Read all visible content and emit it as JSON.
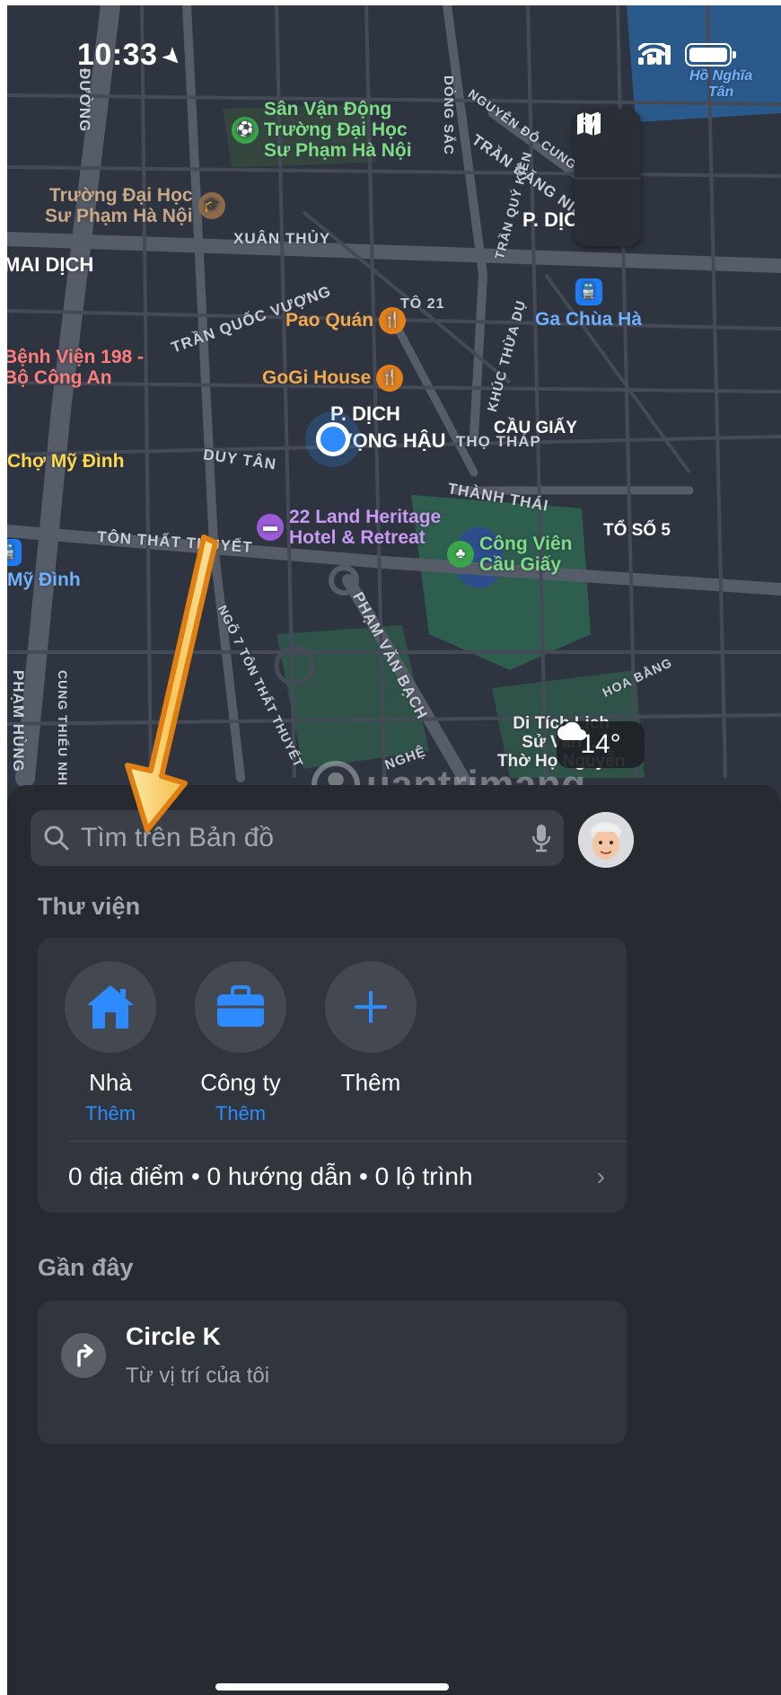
{
  "status_bar": {
    "time": "10:33"
  },
  "map": {
    "roads": [
      "ĐƯỜNG",
      "XUÂN THỦY",
      "TRẦN QUỐC VƯỢNG",
      "DUY TÂN",
      "TÔN THẤT THUYẾT",
      "NGÕ 7 TÔN THẤT THUYẾT",
      "PHẠM VĂN BẠCH",
      "PHẠM HÙNG",
      "CUNG THIẾU NHI",
      "NGUYỄN ĐỖ CUNG",
      "TRẦN ĐĂNG NINH",
      "TRẦN QUÝ KIÊN",
      "KHÚC THỪA DỤ",
      "THỌ THÁP",
      "THÀNH THÁI",
      "TÔ 21",
      "HOA BẰNG",
      "DÒNG SẮC",
      "NGHỆ"
    ],
    "areas": [
      "P. DỊCH",
      "P. DỊCH",
      "VỌNG HẬU",
      "MAI DỊCH",
      "CẦU GIẤY",
      "TỔ SỐ 5"
    ],
    "pois": {
      "stadium": [
        "Sân Vận Động",
        "Trường Đại Học",
        "Sư Phạm Hà Nội"
      ],
      "university": [
        "Trường Đại Học",
        "Sư Phạm Hà Nội"
      ],
      "pao_quan": "Pao Quán",
      "gogi": "GoGi House",
      "hotel": [
        "22 Land Heritage",
        "Hotel & Retreat"
      ],
      "park": [
        "Công Viên",
        "Cầu Giấy"
      ],
      "hospital": [
        "Bệnh Viện 198 -",
        "Bộ Công An"
      ],
      "market": "Chợ Mỹ Đình",
      "station_chua_ha": "Ga Chùa Hà",
      "station_my_dinh": "Mỹ Đình",
      "relic": [
        "Di Tích Lịch",
        "Sử Văn ...",
        "Thờ Họ Nguyễn"
      ],
      "top_right": [
        "Hồ Nghĩa",
        "Tân"
      ]
    },
    "weather": "14°"
  },
  "search": {
    "placeholder": "Tìm trên Bản đồ"
  },
  "library": {
    "title": "Thư viện",
    "favorites": [
      {
        "name": "Nhà",
        "sub": "Thêm"
      },
      {
        "name": "Công ty",
        "sub": "Thêm"
      },
      {
        "name": "Thêm"
      }
    ],
    "summary": "0 địa điểm • 0 hướng dẫn • 0 lộ trình"
  },
  "recent": {
    "title": "Gần đây",
    "items": [
      {
        "title": "Circle K",
        "subtitle": "Từ vị trí của tôi"
      }
    ]
  },
  "watermark": "uantrimang",
  "colors": {
    "accent": "#2d8bff",
    "map_bg": "#2f3540",
    "sheet_bg": "#262a31",
    "annotation_arrow": "#f29a1c"
  }
}
